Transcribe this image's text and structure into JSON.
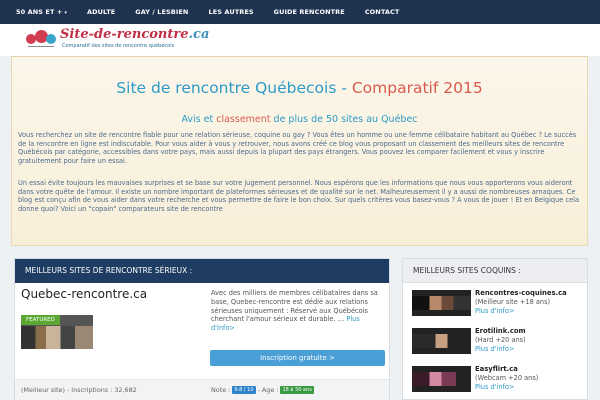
{
  "nav": {
    "items": [
      {
        "label": "50 ANS ET +",
        "caret": "▾"
      },
      {
        "label": "ADULTE",
        "caret": ""
      },
      {
        "label": "GAY / LESBIEN",
        "caret": ""
      },
      {
        "label": "LES AUTRES",
        "caret": ""
      },
      {
        "label": "GUIDE RENCONTRE",
        "caret": ""
      },
      {
        "label": "CONTACT",
        "caret": ""
      }
    ]
  },
  "header": {
    "logo_name": "Site-de-rencontre",
    "logo_tld": ".ca",
    "tagline": "Comparatif des sites de rencontre québécois"
  },
  "intro": {
    "title_main": "Site de rencontre Québecois - ",
    "title_accent": "Comparatif 2015",
    "subtitle_pre": "Avis et ",
    "subtitle_accent": "classement",
    "subtitle_post": " de plus de 50 sites au Québec",
    "paragraph1": "Vous recherchez un site de rencontre fiable pour une relation sérieuse, coquine ou gay ? Vous êtes un homme ou une femme célibataire habitant au Québec ? Le succès de la rencontre en ligne est indiscutable. Pour vous aider à vous y retrouver, nous avons créé ce blog vous proposant un classement des meilleurs sites de rencontre Québécois par catégorie, accessibles dans votre pays, mais aussi depuis la plupart des pays étrangers. Vous pouvez les comparer facilement et vous y inscrire gratuitement pour faire un essai.",
    "paragraph2": "Un essai évite toujours les mauvaises surprises et se base sur votre jugement personnel. Nous espérons que les informations que nous vous apporterons vous aideront dans votre quête de l'amour. Il existe un nombre important de plateformes sérieuses et de qualité sur le net. Malheureusement il y a aussi de nombreuses arnaques. Ce blog est conçu afin de vous aider dans votre recherche et vous permettre de faire le bon choix. Sur quels critères vous basez-vous ? A vous de jouer ! Et en Belgique cela donne quoi? Voici un \"copain\" comparateurs site de rencontre"
  },
  "main": {
    "header": "MEILLEURS SITES DE RENCONTRE SÉRIEUX :",
    "site": {
      "name": "Quebec-rencontre.ca",
      "badge": "FEATURED",
      "description": "Avec des milliers de membres célibataires dans sa base, Quebec-rencontre est dédié aux relations sérieuses uniquement : Réservé aux Québécois cherchant l'amour sérieux et durable. … ",
      "more": "Plus d'info>",
      "cta": "Inscription gratuite >",
      "meta_left": "(Meilleur site) - Inscriptions : 32,682",
      "note_label": "Note : ",
      "note_value": "9.8 / 10",
      "age_label": " - Age : ",
      "age_value": "18 à 50 ans"
    }
  },
  "sidebar": {
    "header": "MEILLEURS SITES COQUINS :",
    "items": [
      {
        "name": "Rencontres-coquines.ca",
        "sub": "(Meilleur site +18 ans)",
        "more": "Plus d'info>"
      },
      {
        "name": "Erotilink.com",
        "sub": "(Hard +20 ans)",
        "more": "Plus d'info>"
      },
      {
        "name": "Easyflirt.ca",
        "sub": "(Webcam +20 ans)",
        "more": "Plus d'info>"
      }
    ]
  }
}
